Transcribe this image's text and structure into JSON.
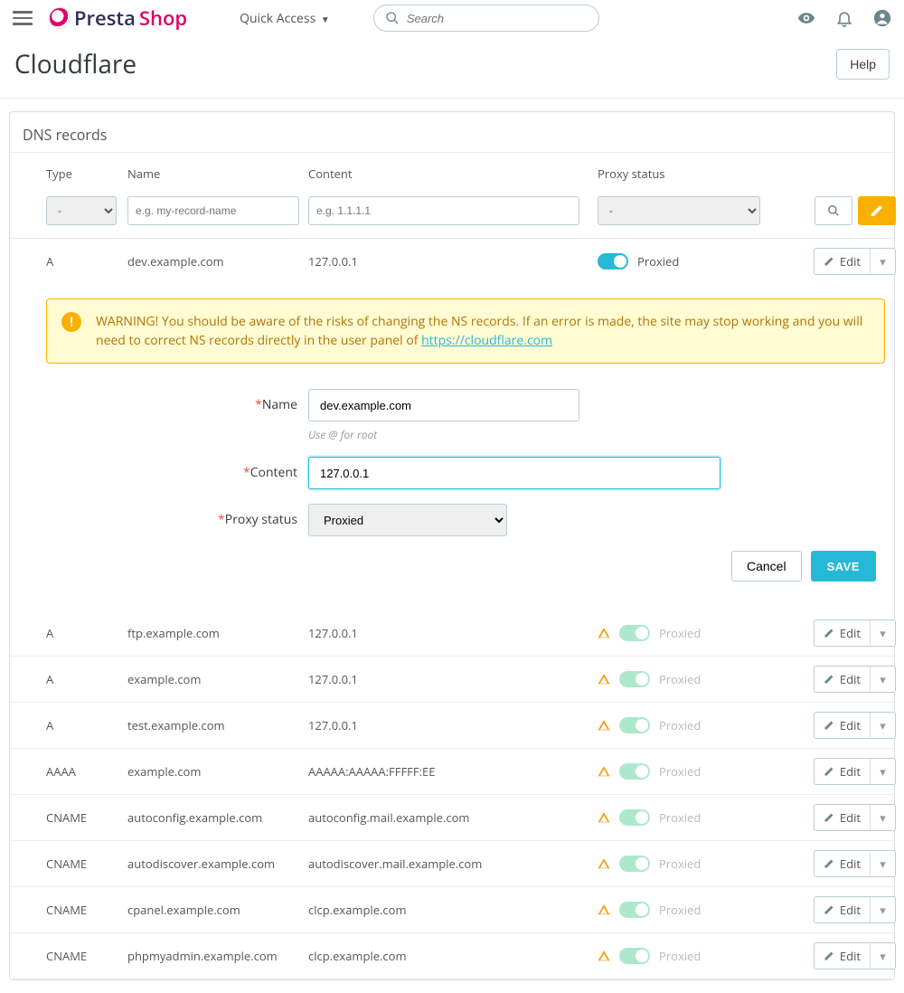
{
  "topbar": {
    "quick_access": "Quick Access",
    "search_placeholder": "Search"
  },
  "page": {
    "title": "Cloudflare",
    "help": "Help"
  },
  "panel": {
    "title": "DNS records"
  },
  "columns": {
    "type": "Type",
    "name": "Name",
    "content": "Content",
    "proxy": "Proxy status"
  },
  "filters": {
    "type_default": "-",
    "name_ph": "e.g. my-record-name",
    "content_ph": "e.g. 1.1.1.1",
    "proxy_default": "-"
  },
  "edit_row": {
    "type": "A",
    "name": "dev.example.com",
    "content": "127.0.0.1",
    "proxy": "Proxied",
    "edit_label": "Edit"
  },
  "alert": {
    "text": "WARNING! You should be aware of the risks of changing the NS records. If an error is made, the site may stop working and you will need to correct NS records directly in the user panel of ",
    "link": "https://cloudflare.com"
  },
  "form": {
    "name_label": "Name",
    "name_value": "dev.example.com",
    "name_hint": "Use @ for root",
    "content_label": "Content",
    "content_value": "127.0.0.1",
    "proxy_label": "Proxy status",
    "proxy_value": "Proxied",
    "cancel": "Cancel",
    "save": "SAVE"
  },
  "proxied_label": "Proxied",
  "edit_label": "Edit",
  "rows": [
    {
      "type": "A",
      "name": "ftp.example.com",
      "content": "127.0.0.1"
    },
    {
      "type": "A",
      "name": "example.com",
      "content": "127.0.0.1"
    },
    {
      "type": "A",
      "name": "test.example.com",
      "content": "127.0.0.1"
    },
    {
      "type": "AAAA",
      "name": "example.com",
      "content": "AAAAA:AAAAA:FFFFF:EE"
    },
    {
      "type": "CNAME",
      "name": "autoconfig.example.com",
      "content": "autoconfig.mail.example.com"
    },
    {
      "type": "CNAME",
      "name": "autodiscover.example.com",
      "content": "autodiscover.mail.example.com"
    },
    {
      "type": "CNAME",
      "name": "cpanel.example.com",
      "content": "clcp.example.com"
    },
    {
      "type": "CNAME",
      "name": "phpmyadmin.example.com",
      "content": "clcp.example.com"
    }
  ]
}
